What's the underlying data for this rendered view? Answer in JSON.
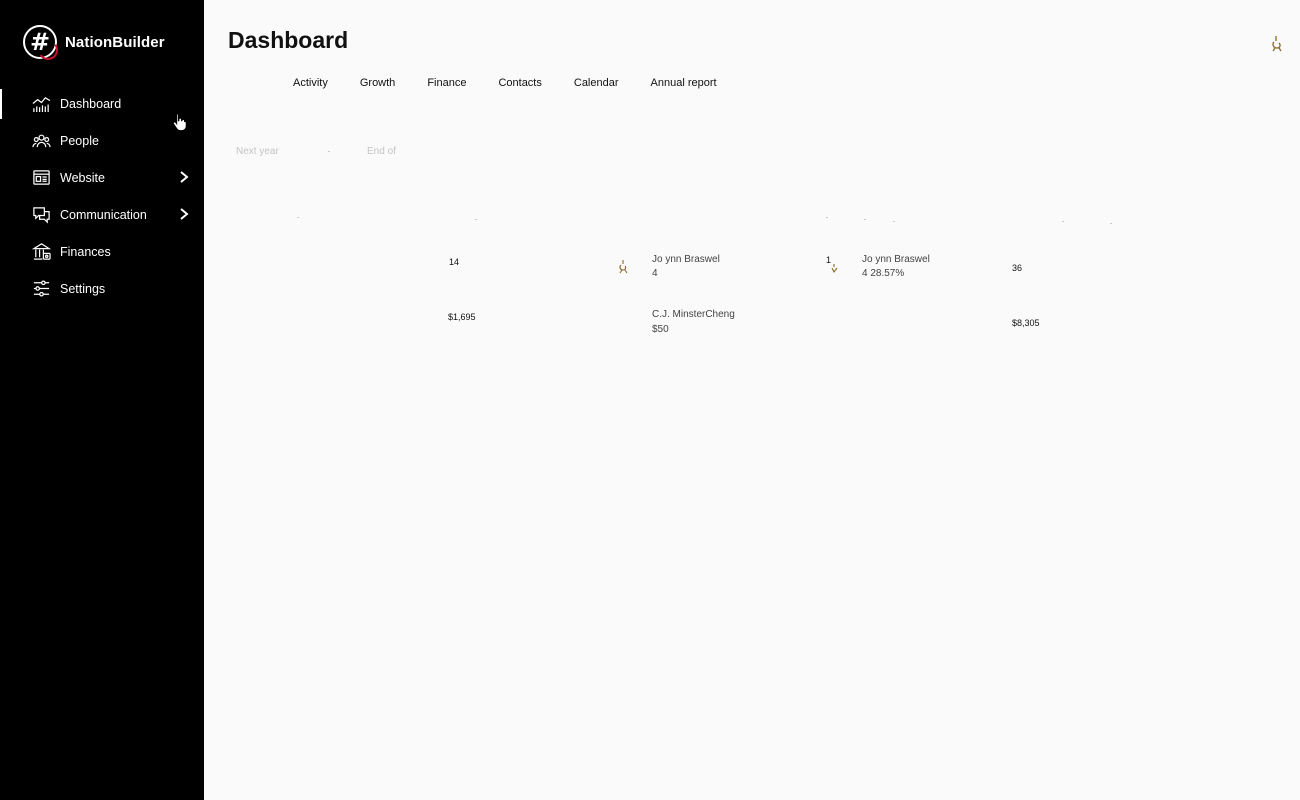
{
  "brand": {
    "name": "NationBuilder",
    "logo_glyph": "#",
    "accent": "#c8102e"
  },
  "sidebar": {
    "items": [
      {
        "label": "Dashboard",
        "icon": "chart-icon",
        "active": true,
        "has_submenu": false
      },
      {
        "label": "People",
        "icon": "people-icon",
        "active": false,
        "has_submenu": false
      },
      {
        "label": "Website",
        "icon": "website-icon",
        "active": false,
        "has_submenu": true
      },
      {
        "label": "Communication",
        "icon": "chat-icon",
        "active": false,
        "has_submenu": true
      },
      {
        "label": "Finances",
        "icon": "bank-icon",
        "active": false,
        "has_submenu": false
      },
      {
        "label": "Settings",
        "icon": "sliders-icon",
        "active": false,
        "has_submenu": false
      }
    ]
  },
  "header": {
    "title": "Dashboard"
  },
  "tabs": [
    "Activity",
    "Growth",
    "Finance",
    "Contacts",
    "Calendar",
    "Annual report"
  ],
  "filters": {
    "start": "Next year",
    "end": "End of"
  },
  "stats": {
    "row1": {
      "value_a": "14",
      "top_name": "Jo ynn Braswel",
      "top_count": "4",
      "rank": "1",
      "second_name": "Jo ynn Braswel",
      "second_detail": "4  28.57%",
      "value_b": "36"
    },
    "row2": {
      "value_a": "$1,695",
      "top_name": "C.J. MinsterCheng",
      "top_amount": "$50",
      "value_b": "$8,305"
    }
  }
}
